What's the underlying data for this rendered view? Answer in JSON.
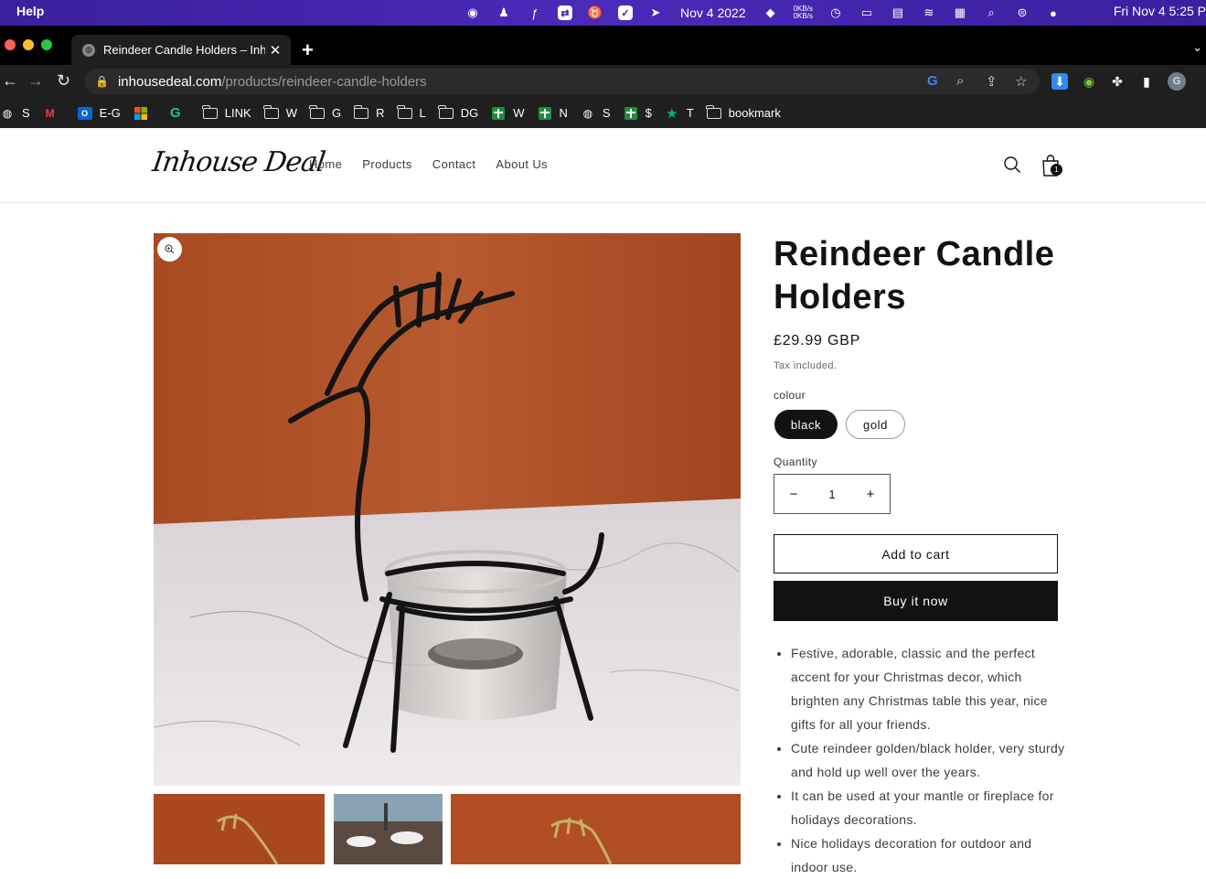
{
  "menubar": {
    "app_menu": "Help",
    "date": "Nov 4 2022",
    "net_up": "0KB/s",
    "net_down": "0KB/s",
    "clock": "Fri Nov 4  5:25 P"
  },
  "browser": {
    "tab_title": "Reindeer Candle Holders – Inhouse Deal",
    "url_domain": "inhousedeal.com",
    "url_path": "/products/reindeer-candle-holders",
    "profile_initial": "G",
    "bookmarks": [
      {
        "label": "S",
        "icon": "globe-icon"
      },
      {
        "label": "",
        "icon": "gmail-icon"
      },
      {
        "label": "E-G",
        "icon": "outlook-icon"
      },
      {
        "label": "",
        "icon": "microsoft-icon"
      },
      {
        "label": "",
        "icon": "grammarly-icon"
      },
      {
        "label": "LINK",
        "icon": "folder-icon"
      },
      {
        "label": "W",
        "icon": "folder-icon"
      },
      {
        "label": "G",
        "icon": "folder-icon"
      },
      {
        "label": "R",
        "icon": "folder-icon"
      },
      {
        "label": "L",
        "icon": "folder-icon"
      },
      {
        "label": "DG",
        "icon": "folder-icon"
      },
      {
        "label": "W",
        "icon": "sheets-icon"
      },
      {
        "label": "N",
        "icon": "sheets-icon"
      },
      {
        "label": "S",
        "icon": "globe-icon"
      },
      {
        "label": "$",
        "icon": "sheets-icon"
      },
      {
        "label": "T",
        "icon": "star-icon"
      },
      {
        "label": "bookmark",
        "icon": "folder-icon"
      }
    ]
  },
  "store": {
    "logo": "Inhouse Deal",
    "nav": [
      "Home",
      "Products",
      "Contact",
      "About Us"
    ],
    "cart_count": "1"
  },
  "product": {
    "title": "Reindeer Candle Holders",
    "price": "£29.99 GBP",
    "tax_note": "Tax included.",
    "option_label": "colour",
    "options": [
      "black",
      "gold"
    ],
    "selected_option": "black",
    "quantity_label": "Quantity",
    "quantity": "1",
    "minus": "−",
    "plus": "+",
    "add_to_cart": "Add to cart",
    "buy_now": "Buy it now",
    "description": [
      "Festive, adorable, classic and the perfect accent for your Christmas decor, which brighten any Christmas table this year, nice gifts for all your friends.",
      "Cute reindeer golden/black holder, very sturdy and hold up well over the years.",
      "It can be used at your mantle or fireplace for holidays decorations.",
      "Nice holidays decoration for outdoor and indoor use."
    ]
  },
  "colors": {
    "menubar": "#3a1f9e",
    "browser_chrome": "#1f1f1f",
    "primary_button": "#121212",
    "photo_backdrop": "#b5532a"
  }
}
